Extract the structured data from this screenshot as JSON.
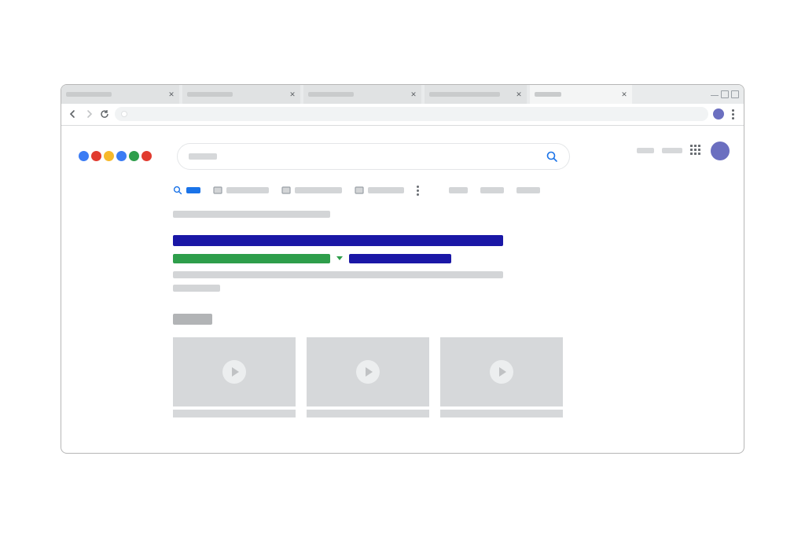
{
  "browser": {
    "tabs": [
      {
        "title": "",
        "active": false
      },
      {
        "title": "",
        "active": false
      },
      {
        "title": "",
        "active": false
      },
      {
        "title": "",
        "active": false
      },
      {
        "title": "",
        "active": true
      }
    ],
    "url": ""
  },
  "logo_colors": [
    "#3b7cf4",
    "#e13b2f",
    "#f7b92b",
    "#3b7cf4",
    "#2e9e4b",
    "#e13b2f"
  ],
  "search": {
    "query": ""
  },
  "account": {
    "link1": "",
    "link2": ""
  },
  "filters": [
    {
      "label": "",
      "type": "all",
      "active": true
    },
    {
      "label": "",
      "type": "images",
      "active": false
    },
    {
      "label": "",
      "type": "videos",
      "active": false
    },
    {
      "label": "",
      "type": "news",
      "active": false
    }
  ],
  "extra_filters": [
    {
      "label": ""
    },
    {
      "label": ""
    },
    {
      "label": ""
    }
  ],
  "results": {
    "stats": "",
    "first": {
      "title": "",
      "url": "",
      "sublink": "",
      "description_line1": "",
      "description_line2": ""
    },
    "videos_heading": "",
    "videos": [
      {
        "title": ""
      },
      {
        "title": ""
      },
      {
        "title": ""
      }
    ]
  }
}
